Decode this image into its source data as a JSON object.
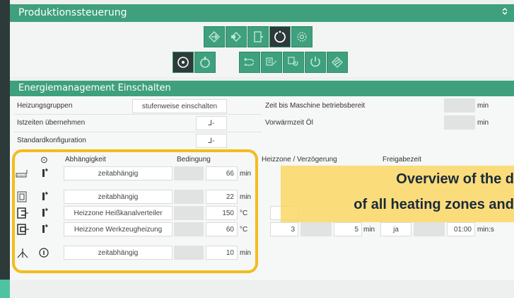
{
  "header": {
    "title": "Produktionssteuerung",
    "collapse_icon": "chevron-up-down-icon"
  },
  "toolbar": {
    "row1": [
      "sync-arrows-icon",
      "fill-sequence-icon",
      "mold-open-icon",
      "power-cycle-icon",
      "settings-gear-icon"
    ],
    "row2": [
      "manual-mode-icon",
      "auto-mode-icon",
      "sequence-icon",
      "heating-program-icon",
      "heating-power-icon",
      "power-icon",
      "checklist-icon"
    ],
    "active": "power-cycle-icon"
  },
  "section": {
    "title": "Energiemanagement Einschalten"
  },
  "settings": {
    "heizungsgruppen": {
      "label": "Heizungsgruppen",
      "value": "stufenweise einschalten"
    },
    "istzeiten": {
      "label": "Istzeiten übernehmen",
      "value": "⅃-"
    },
    "standard": {
      "label": "Standardkonfiguration",
      "value": "⅃-"
    },
    "zeit_betriebsbereit": {
      "label": "Zeit bis Maschine betriebsbereit",
      "value": "",
      "unit": "min"
    },
    "vorwaermzeit": {
      "label": "Vorwärmzeit Öl",
      "value": "",
      "unit": "min"
    }
  },
  "table": {
    "headers": {
      "status": "⊙",
      "abhaengigkeit": "Abhängigkeit",
      "bedingung": "Bedingung"
    },
    "rows": [
      {
        "zone_icon": "nozzle-heater-icon",
        "status_icon": "thermo-arrow-icon",
        "dependency": "zeitabhängig",
        "value": "66",
        "unit": "min"
      },
      {
        "zone_icon": "mold-zone-icon",
        "status_icon": "thermo-arrow-icon",
        "dependency": "zeitabhängig",
        "value": "22",
        "unit": "min"
      },
      {
        "zone_icon": "hotrunner-manifold-icon",
        "status_icon": "thermo-arrow-icon",
        "dependency": "Heizzone Heißkanalverteiler",
        "value": "150",
        "unit": "°C"
      },
      {
        "zone_icon": "mold-heater-icon",
        "status_icon": "thermo-arrow-icon",
        "dependency": "Heizzone Werkzeugheizung",
        "value": "60",
        "unit": "°C"
      },
      {
        "zone_icon": "oil-preheat-icon",
        "status_icon": "info-circle-icon",
        "dependency": "zeitabhängig",
        "value": "10",
        "unit": "min"
      }
    ]
  },
  "right_table": {
    "headers": {
      "heizzone": "Heizzone / Verzögerung",
      "freigabe": "Freigabezeit"
    },
    "row4": {
      "zone": "3",
      "delay": "5",
      "delay_unit": "min",
      "release": "ja",
      "time": "01:00",
      "time_unit": "min:s"
    }
  },
  "overlay": {
    "line1": "Overview of the d",
    "line2": "of all heating zones and"
  },
  "colors": {
    "accent": "#3fa07d",
    "highlight": "#f2bd1c",
    "overlay": "#fad65f"
  }
}
